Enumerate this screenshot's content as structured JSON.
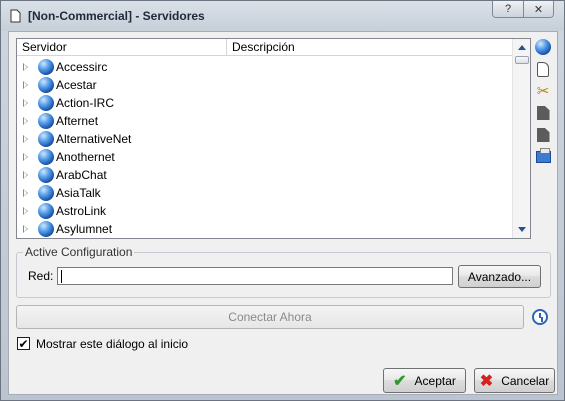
{
  "window": {
    "title": "[Non-Commercial] - Servidores",
    "title_buttons": [
      "?",
      "✕"
    ]
  },
  "server_list": {
    "columns": [
      "Servidor",
      "Descripción"
    ],
    "rows": [
      {
        "name": "Accessirc",
        "description": ""
      },
      {
        "name": "Acestar",
        "description": ""
      },
      {
        "name": "Action-IRC",
        "description": ""
      },
      {
        "name": "Afternet",
        "description": ""
      },
      {
        "name": "AlternativeNet",
        "description": ""
      },
      {
        "name": "Anothernet",
        "description": ""
      },
      {
        "name": "ArabChat",
        "description": ""
      },
      {
        "name": "AsiaTalk",
        "description": ""
      },
      {
        "name": "AstroLink",
        "description": ""
      },
      {
        "name": "Asylumnet",
        "description": ""
      }
    ]
  },
  "toolbar_icons": [
    "globe-icon",
    "document-icon",
    "scissors-icon",
    "copy-icon",
    "paste-icon",
    "folder-open-icon"
  ],
  "active_config": {
    "legend": "Active Configuration",
    "red_label": "Red:",
    "red_value": "",
    "advanced_button": "Avanzado..."
  },
  "connect_button": "Conectar Ahora",
  "show_on_start": {
    "label": "Mostrar este diálogo al inicio",
    "checked": true
  },
  "footer": {
    "ok_label": "Aceptar",
    "cancel_label": "Cancelar"
  }
}
